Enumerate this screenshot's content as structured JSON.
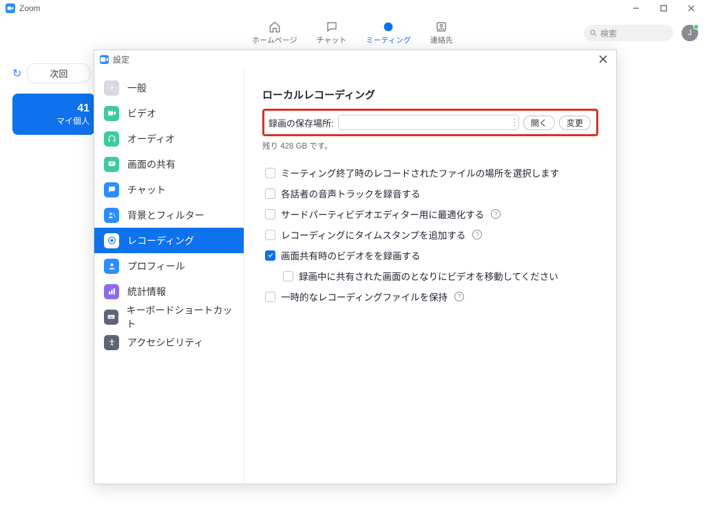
{
  "app": {
    "title": "Zoom"
  },
  "nav": {
    "tabs": [
      {
        "label": "ホームページ"
      },
      {
        "label": "チャット"
      },
      {
        "label": "ミーティング"
      },
      {
        "label": "連絡先"
      }
    ],
    "search_placeholder": "検索",
    "avatar_initial": "J"
  },
  "bg": {
    "next_label": "次回",
    "card_number": "41",
    "card_label": "マイ個人"
  },
  "dialog": {
    "title": "設定"
  },
  "sidebar": {
    "items": [
      {
        "label": "一般"
      },
      {
        "label": "ビデオ"
      },
      {
        "label": "オーディオ"
      },
      {
        "label": "画面の共有"
      },
      {
        "label": "チャット"
      },
      {
        "label": "背景とフィルター"
      },
      {
        "label": "レコーディング"
      },
      {
        "label": "プロフィール"
      },
      {
        "label": "統計情報"
      },
      {
        "label": "キーボードショートカット"
      },
      {
        "label": "アクセシビリティ"
      }
    ]
  },
  "panel": {
    "heading": "ローカルレコーディング",
    "location_label": "録画の保存場所:",
    "open_button": "開く",
    "change_button": "変更",
    "remaining": "残り 428 GB です。",
    "options": [
      {
        "label": "ミーティング終了時のレコードされたファイルの場所を選択します",
        "checked": false,
        "help": false
      },
      {
        "label": "各話者の音声トラックを録音する",
        "checked": false,
        "help": false
      },
      {
        "label": "サードパーティビデオエディター用に最適化する",
        "checked": false,
        "help": true
      },
      {
        "label": "レコーディングにタイムスタンプを追加する",
        "checked": false,
        "help": true
      },
      {
        "label": "画面共有時のビデオをを録画する",
        "checked": true,
        "help": false
      },
      {
        "label": "録画中に共有された画面のとなりにビデオを移動してください",
        "checked": false,
        "help": false,
        "sub": true
      },
      {
        "label": "一時的なレコーディングファイルを保持",
        "checked": false,
        "help": true
      }
    ]
  }
}
